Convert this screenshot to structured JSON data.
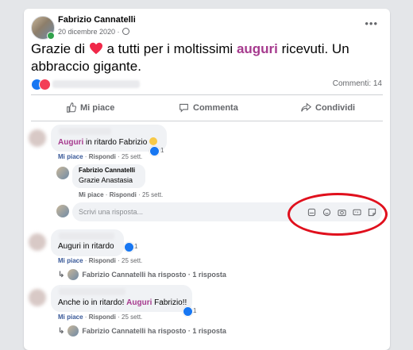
{
  "post": {
    "author": "Fabrizio Cannatelli",
    "date": "20 dicembre 2020 ·",
    "text_before": "Grazie di",
    "text_mid": "a tutti per i moltissimi",
    "highlight": "auguri",
    "text_after": "ricevuti. Un abbraccio gigante.",
    "comments_count": "Commenti: 14"
  },
  "actions": {
    "like": "Mi piace",
    "comment": "Commenta",
    "share": "Condividi"
  },
  "comments": [
    {
      "highlight": "Auguri",
      "text": "in ritardo Fabrizio",
      "reaction_count": "1",
      "like": "Mi piace",
      "reply": "Rispondi",
      "time": "· 25 sett.",
      "reply_item": {
        "author": "Fabrizio Cannatelli",
        "text": "Grazie Anastasia",
        "like": "Mi piace",
        "reply": "Rispondi",
        "time": "· 25 sett."
      }
    },
    {
      "text": "Auguri in ritardo",
      "reaction_count": "1",
      "like": "Mi piace",
      "reply": "Rispondi",
      "time": "· 25 sett.",
      "replies": "Fabrizio Cannatelli ha risposto · 1 risposta"
    },
    {
      "text_before": "Anche io in ritardo!",
      "highlight": "Auguri",
      "text_after": "Fabrizio!!",
      "reaction_count": "1",
      "like": "Mi piace",
      "reply": "Rispondi",
      "time": "· 25 sett.",
      "replies": "Fabrizio Cannatelli ha risposto · 1 risposta"
    }
  ],
  "reply_input": {
    "placeholder": "Scrivi una risposta..."
  },
  "colors": {
    "highlight": "#a63a8e",
    "link_blue": "#385898",
    "annotation_red": "#e0101d"
  },
  "icons": [
    "sticker-icon",
    "emoji-icon",
    "camera-icon",
    "gif-icon",
    "sticker-face-icon"
  ]
}
